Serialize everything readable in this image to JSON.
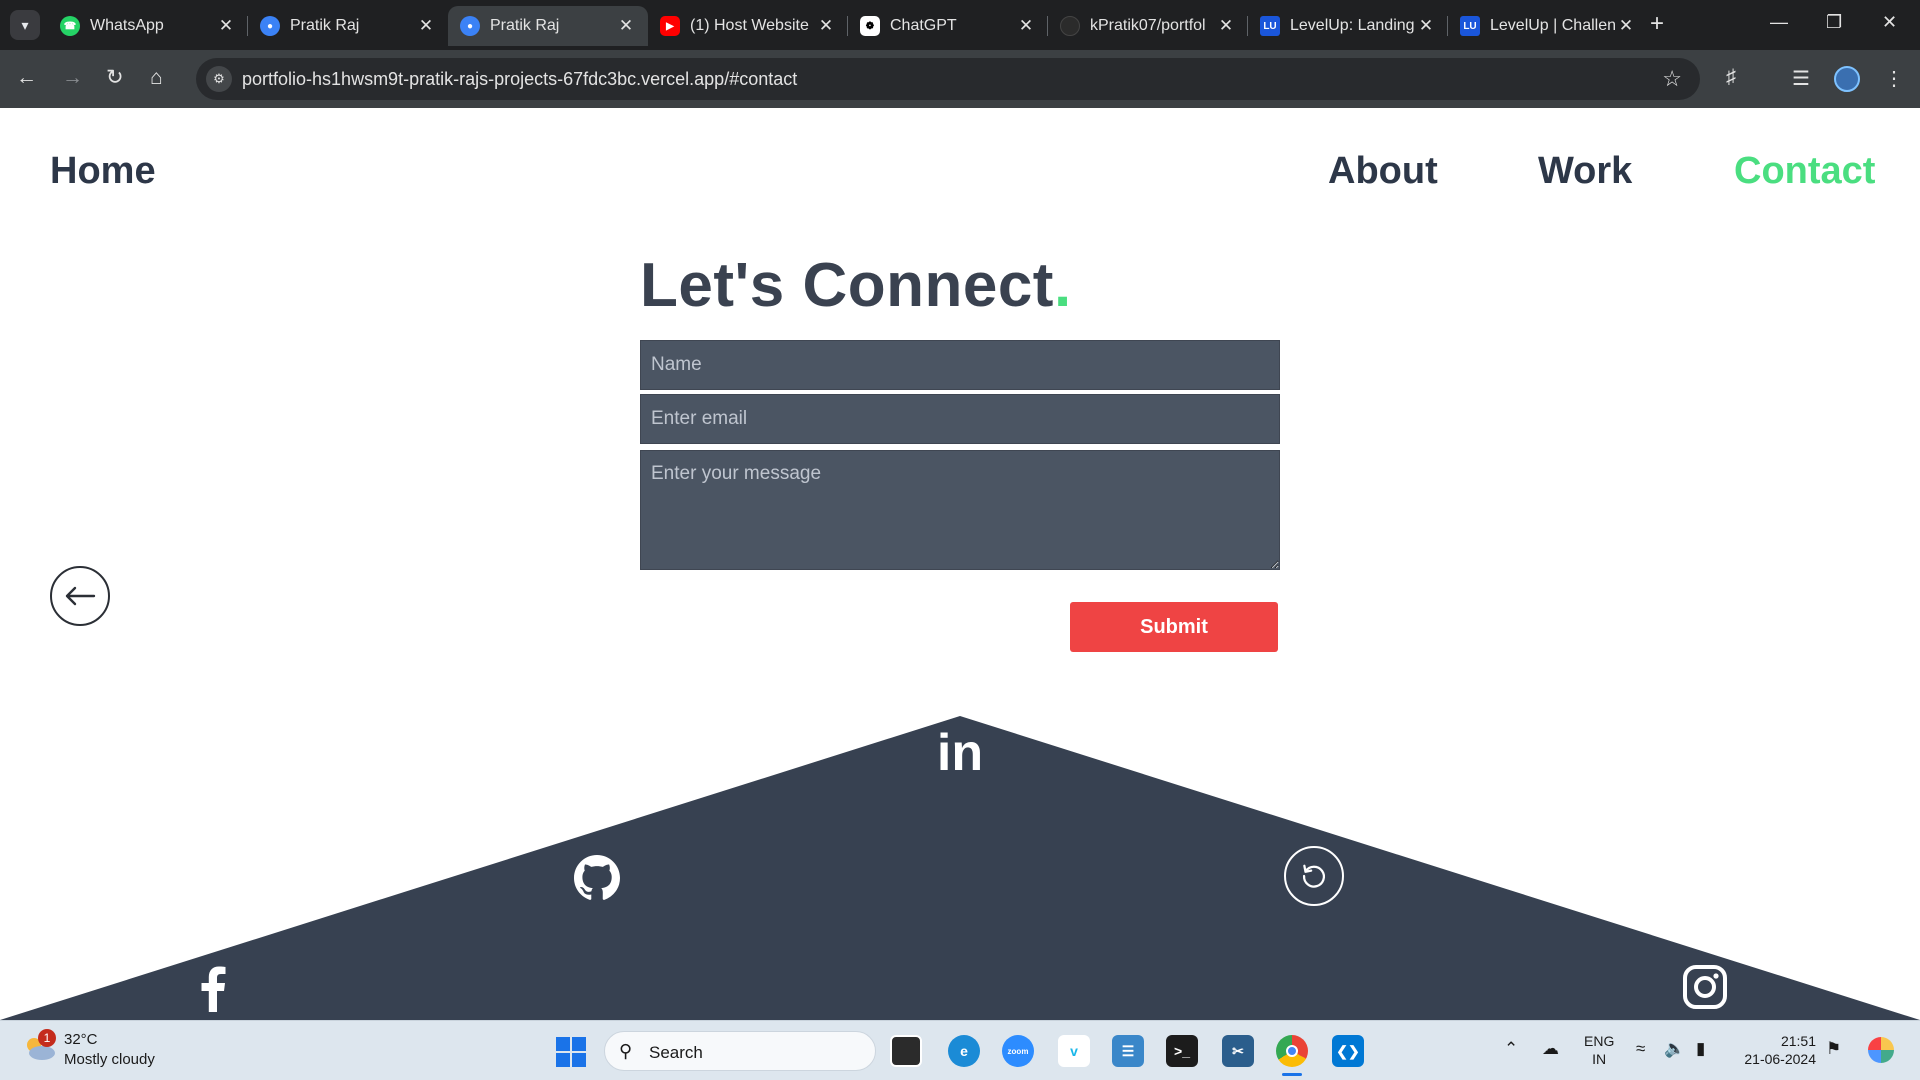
{
  "browser": {
    "tabs": [
      {
        "title": "WhatsApp",
        "favicon": "whatsapp-icon",
        "color": "#25d366"
      },
      {
        "title": "Pratik Raj",
        "favicon": "user-icon",
        "color": "#3b82f6"
      },
      {
        "title": "Pratik Raj",
        "favicon": "user-icon",
        "color": "#3b82f6"
      },
      {
        "title": "(1) Host Website",
        "favicon": "youtube-icon",
        "color": "#ff0000"
      },
      {
        "title": "ChatGPT",
        "favicon": "chatgpt-icon",
        "color": "#ffffff"
      },
      {
        "title": "kPratik07/portfol",
        "favicon": "github-icon",
        "color": "#2b2b2b"
      },
      {
        "title": "LevelUp: Landing",
        "favicon": "levelup-icon",
        "color": "#1a56db"
      },
      {
        "title": "LevelUp | Challen",
        "favicon": "levelup-icon",
        "color": "#1a56db"
      }
    ],
    "active_tab_index": 2,
    "levelup_badge": "LU",
    "url": "portfolio-hs1hwsm9t-pratik-rajs-projects-67fdc3bc.vercel.app/#contact"
  },
  "nav": {
    "home": "Home",
    "about": "About",
    "work": "Work",
    "contact": "Contact"
  },
  "contact": {
    "heading": "Let's Connect",
    "heading_dot": ".",
    "name_placeholder": "Name",
    "email_placeholder": "Enter email",
    "message_placeholder": "Enter your message",
    "submit_label": "Submit"
  },
  "social": {
    "linkedin": "in",
    "icons": [
      "linkedin-icon",
      "github-icon",
      "refresh-icon",
      "facebook-icon",
      "instagram-icon"
    ]
  },
  "colors": {
    "accent": "#4ade80",
    "submit": "#ef4444",
    "footer": "#374151",
    "field": "#4b5563"
  },
  "taskbar": {
    "weather_temp": "32°C",
    "weather_desc": "Mostly cloudy",
    "weather_badge": "1",
    "search_label": "Search",
    "zoom_label": "zoom",
    "lang_line1": "ENG",
    "lang_line2": "IN",
    "time": "21:51",
    "date": "21-06-2024"
  }
}
